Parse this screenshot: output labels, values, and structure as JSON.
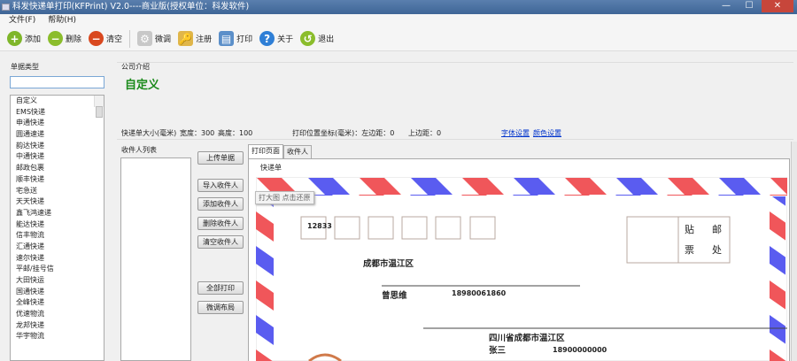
{
  "window": {
    "title": "科发快递单打印(KFPrint) V2.0----商业版(授权单位：科发软件)",
    "minimize": "—",
    "maximize": "☐",
    "close": "✕"
  },
  "menu": [
    "文件(F)",
    "帮助(H)"
  ],
  "toolbar": [
    {
      "label": "添加",
      "icon": "add-icon",
      "color": "#7fb62a",
      "glyph": "+"
    },
    {
      "label": "删除",
      "icon": "remove-icon",
      "color": "#8bbd2c",
      "glyph": "−"
    },
    {
      "label": "清空",
      "icon": "clear-icon",
      "color": "#d9481f",
      "glyph": "−"
    },
    {
      "label": "微调",
      "icon": "gear-icon",
      "color": "#c8c8c8",
      "glyph": "⚙"
    },
    {
      "label": "注册",
      "icon": "key-icon",
      "color": "#e0b64a",
      "glyph": "🔑"
    },
    {
      "label": "打印",
      "icon": "printer-icon",
      "color": "#5b8fc9",
      "glyph": "▤"
    },
    {
      "label": "关于",
      "icon": "help-icon",
      "color": "#2f7fd6",
      "glyph": "?"
    },
    {
      "label": "退出",
      "icon": "exit-icon",
      "color": "#8bbd2c",
      "glyph": "↺"
    }
  ],
  "left": {
    "title": "单据类型",
    "search_value": "",
    "items": [
      "自定义",
      "EMS快递",
      "申通快递",
      "圆通速递",
      "韵达快递",
      "中通快递",
      "邮政包裹",
      "顺丰快递",
      "宅急送",
      "天天快递",
      "鑫飞鸿速递",
      "能达快递",
      "信丰物流",
      "汇通快递",
      "速尔快递",
      "平邮/挂号信",
      "大田快运",
      "国通快递",
      "全峰快递",
      "优速物流",
      "龙邦快递",
      "华宇物流"
    ]
  },
  "company": {
    "label": "公司介绍",
    "name": "自定义"
  },
  "info": {
    "size_label": "快递单大小(毫米)",
    "width_label": "宽度：300",
    "height_label": "高度：100",
    "pos_label": "打印位置坐标(毫米)：左边距：0",
    "top_label": "上边距：0",
    "font_link": "字体设置",
    "color_link": "颜色设置"
  },
  "recipients": {
    "label": "收件人列表"
  },
  "buttons": [
    "上传单据",
    "导入收件人",
    "添加收件人",
    "删除收件人",
    "清空收件人",
    "全部打印",
    "微调布局"
  ],
  "tabs": [
    "打印页面",
    "收件人"
  ],
  "sheet": {
    "group_label": "快递单",
    "tooltip": "打大图 点击还原",
    "zip": "12833",
    "stamp": [
      "贴",
      "邮",
      "票",
      "处"
    ],
    "sender_address": "成都市温江区",
    "sender_name": "曾思维",
    "sender_phone": "18980061860",
    "receiver_address": "四川省成都市温江区",
    "receiver_name": "张三",
    "receiver_phone": "18900000000"
  },
  "colors": {
    "stripe_red": "#f0565a",
    "stripe_blue": "#5a5cf0",
    "company_green": "#1a8a1a"
  }
}
